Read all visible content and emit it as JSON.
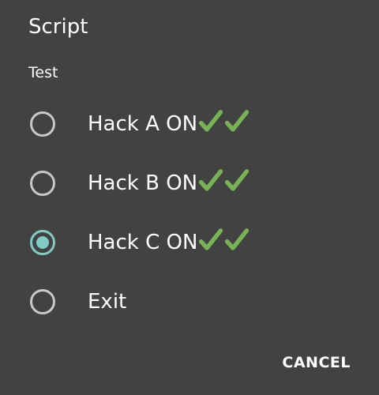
{
  "dialog": {
    "title": "Script",
    "message": "Test",
    "options": [
      {
        "label": "Hack A ON",
        "icons": [
          "check-mark-icon",
          "check-mark-icon"
        ],
        "selected": false
      },
      {
        "label": "Hack B ON",
        "icons": [
          "check-mark-icon",
          "check-mark-icon"
        ],
        "selected": false
      },
      {
        "label": "Hack C ON",
        "icons": [
          "check-mark-icon",
          "check-mark-icon"
        ],
        "selected": true
      },
      {
        "label": "Exit",
        "icons": [],
        "selected": false
      }
    ],
    "cancel_label": "CANCEL"
  },
  "colors": {
    "background": "#424242",
    "accent": "#80cbc4",
    "radio_unchecked": "#c8c8c8",
    "check_mark": "#77b255"
  }
}
